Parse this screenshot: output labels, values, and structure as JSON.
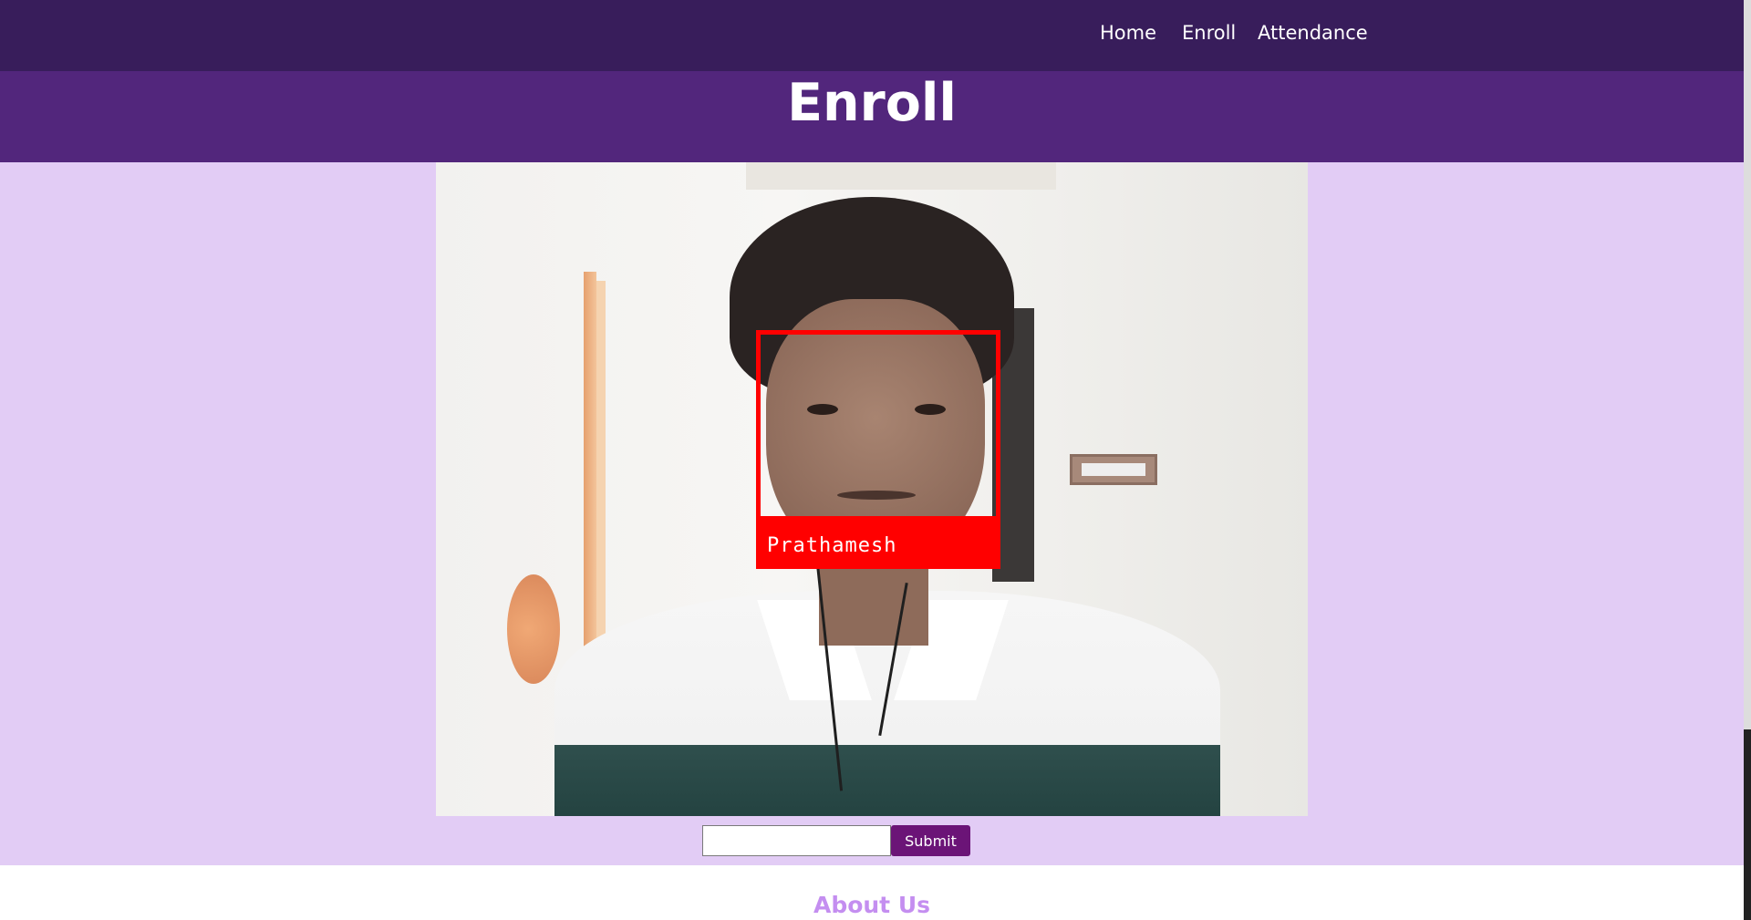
{
  "nav": {
    "links": [
      {
        "label": "Home"
      },
      {
        "label": "Enroll"
      },
      {
        "label": "Attendance"
      }
    ]
  },
  "hero": {
    "title": "Enroll"
  },
  "camera": {
    "detected_name": "Prathamesh"
  },
  "form": {
    "input_value": "",
    "input_placeholder": "",
    "submit_label": "Submit"
  },
  "footer": {
    "heading": "About Us"
  },
  "colors": {
    "navbar": "#381d5b",
    "hero": "#52267c",
    "background": "#e2ccf5",
    "button": "#6b1477",
    "detection_box": "#ff0000",
    "about_heading": "#c48ef0"
  }
}
